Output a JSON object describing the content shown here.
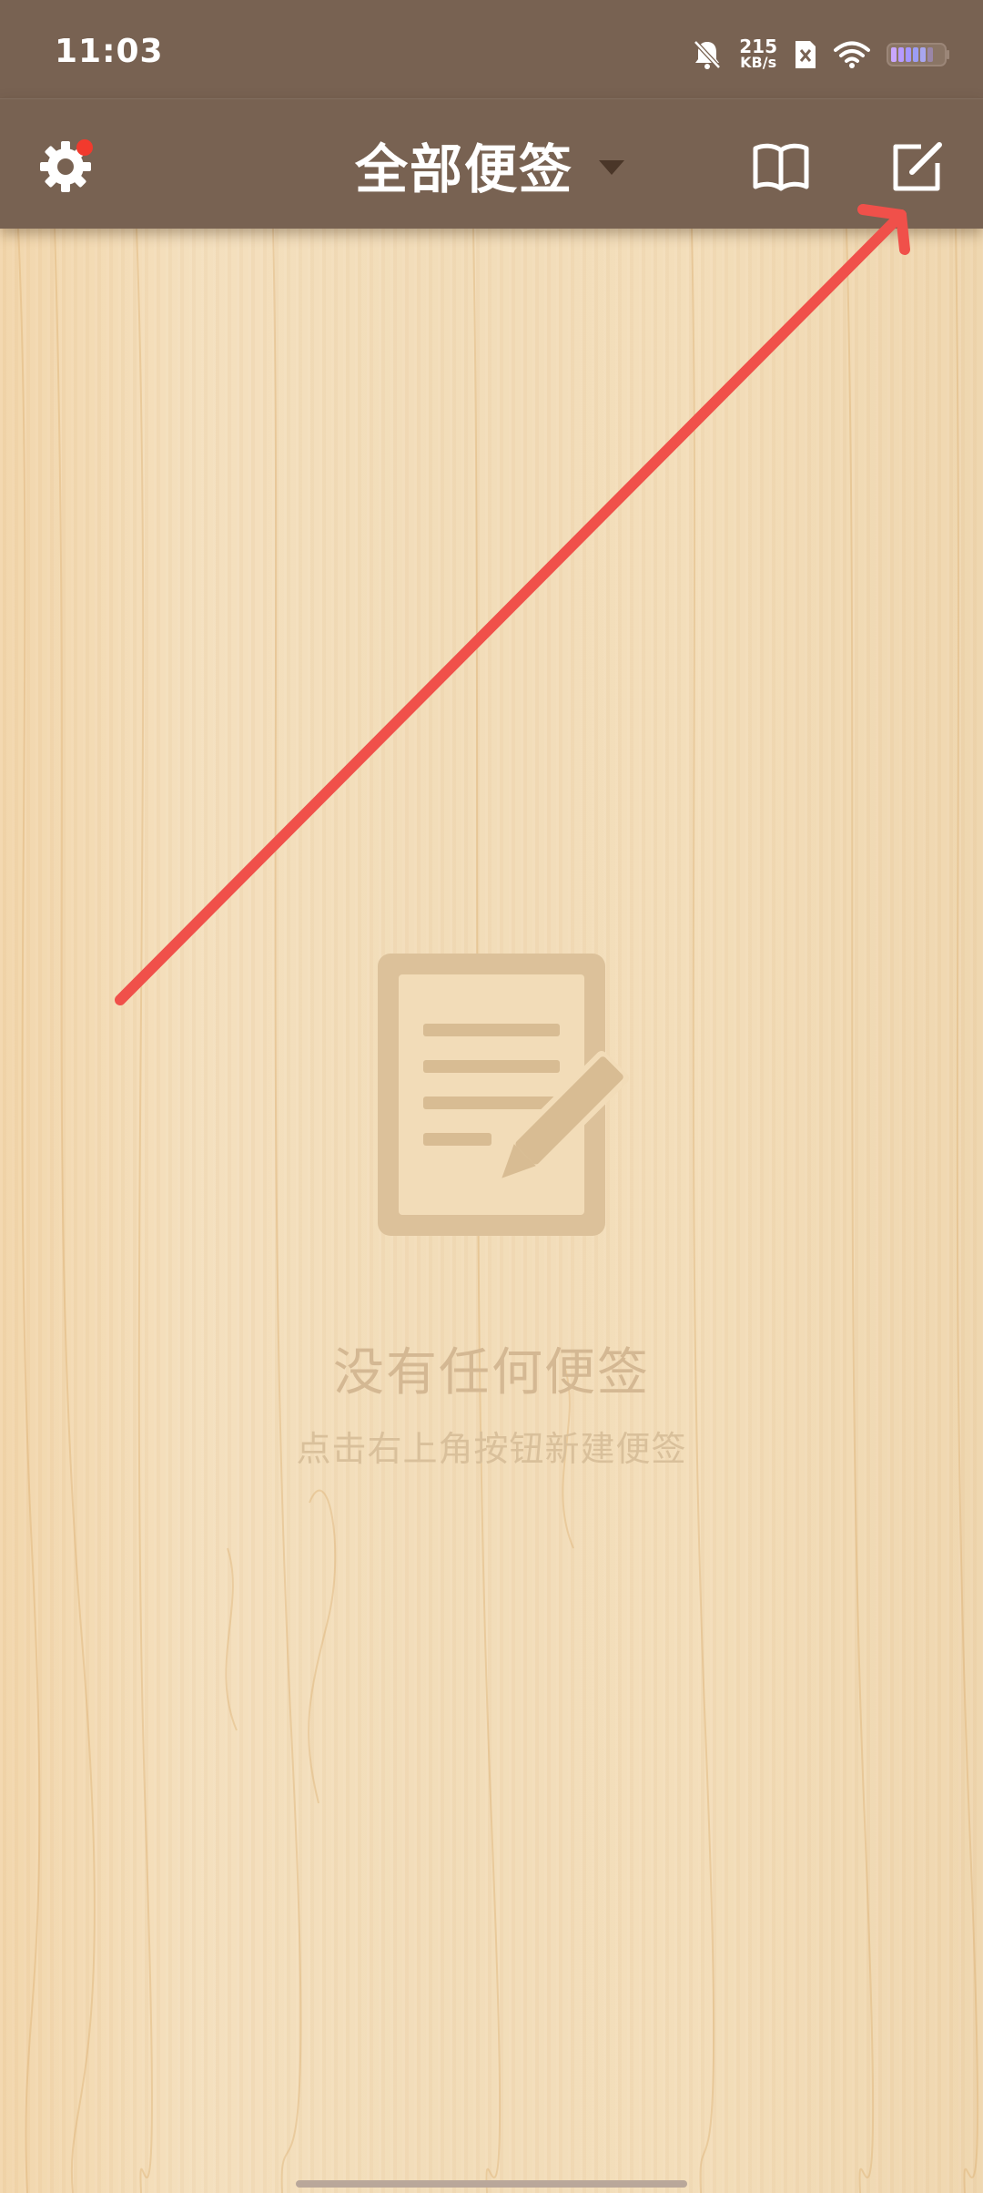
{
  "status_bar": {
    "time": "11:03",
    "net_speed_value": "215",
    "net_speed_unit": "KB/s",
    "icons": [
      "bell-off-icon",
      "sim-x-icon",
      "wifi-icon",
      "battery-icon"
    ]
  },
  "app_bar": {
    "title": "全部便签",
    "settings_icon": "gear-icon",
    "book_icon": "book-icon",
    "new_note_icon": "edit-note-icon",
    "settings_badge_color": "#f23a2d"
  },
  "empty_state": {
    "illustration_icon": "note-with-pencil-icon",
    "title": "没有任何便签",
    "subtitle": "点击右上角按钮新建便签"
  },
  "annotation": {
    "arrow_color": "#f0504a",
    "arrow_icon": "red-arrow-annotation"
  },
  "colors": {
    "bar": "#786252",
    "background": "#f0d9b5"
  }
}
